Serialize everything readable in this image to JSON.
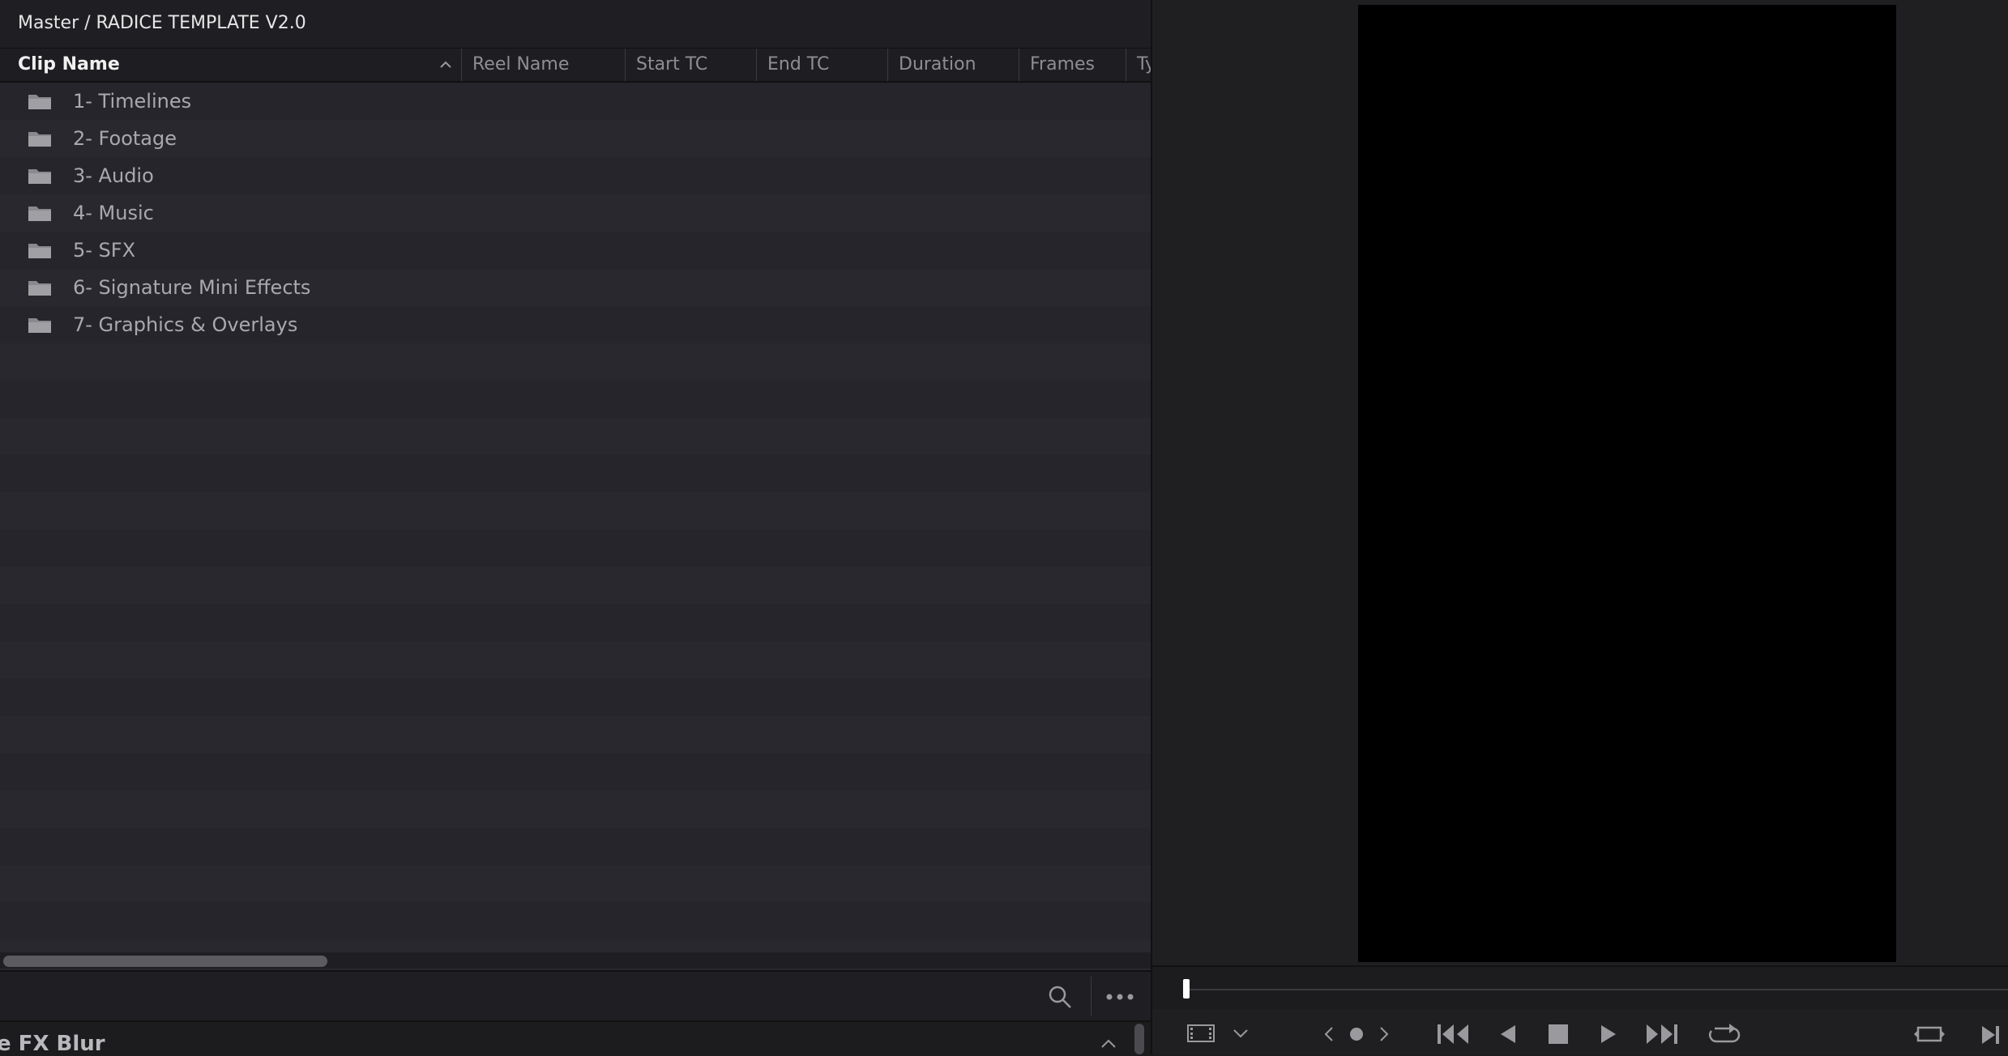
{
  "media_pool": {
    "breadcrumb": "Master / RADICE TEMPLATE V2.0",
    "columns": [
      "Clip Name",
      "Reel Name",
      "Start TC",
      "End TC",
      "Duration",
      "Frames",
      "Ty"
    ],
    "items": [
      {
        "label": "1- Timelines",
        "icon": "folder-icon"
      },
      {
        "label": "2- Footage",
        "icon": "folder-icon"
      },
      {
        "label": "3- Audio",
        "icon": "folder-icon"
      },
      {
        "label": "4- Music",
        "icon": "folder-icon"
      },
      {
        "label": "5- SFX",
        "icon": "folder-icon"
      },
      {
        "label": "6- Signature Mini Effects",
        "icon": "folder-icon"
      },
      {
        "label": "7- Graphics & Overlays",
        "icon": "folder-icon"
      }
    ],
    "footer_icons": [
      "search-icon",
      "more-icon"
    ]
  },
  "lower_panel": {
    "title": "e FX Blur"
  },
  "viewer": {
    "transport_icons": [
      "clip-view-icon",
      "chevron-down-icon",
      "prev-marker-icon",
      "marker-dot-icon",
      "next-marker-icon",
      "skip-to-start-icon",
      "play-reverse-icon",
      "stop-icon",
      "play-icon",
      "skip-to-end-icon",
      "loop-icon",
      "match-frame-icon",
      "next-edit-icon"
    ]
  },
  "colors": {
    "pool_bg": "#28282e",
    "stripe_alt": "#25252b",
    "header_bg": "#1e1e22",
    "viewer_canvas": "#000000",
    "icon_grey": "#8a8a8e"
  }
}
